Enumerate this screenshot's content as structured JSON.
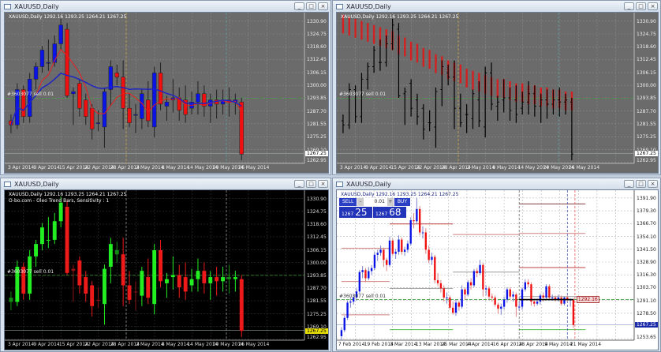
{
  "colors": {
    "gray_bg": "#6b6b6b",
    "black_bg": "#000000",
    "white_bg": "#ffffff",
    "bull_blue": "#0a14e6",
    "bear_red": "#f01010",
    "ma_fast": "#e82020",
    "ma_slow": "#1a22c8",
    "trend_red": "#d42020",
    "oleo_up_strong": "#22ee22",
    "oleo_up_weak": "#148c14",
    "oleo_down_strong": "#ee1a1a",
    "oleo_down_weak": "#8c1414",
    "order_line": "#40a040"
  },
  "common": {
    "window_title": "XAUUSD,Daily",
    "header": "XAUUSD,Daily  1292.16 1293.25 1264.21 1267.25",
    "order_label": "#3603077 sell 0.01",
    "current_price": "1267.25",
    "window_buttons": [
      "minimize-icon",
      "maximize-icon",
      "close-icon"
    ]
  },
  "top_charts": {
    "ylim": [
      1262.5,
      1335
    ],
    "price_labels": [
      "1330.90",
      "1324.75",
      "1318.60",
      "1312.45",
      "1306.15",
      "1300.00",
      "1293.85",
      "1287.70",
      "1281.55",
      "1275.25",
      "1269.10",
      "1262.95"
    ],
    "date_labels": [
      "3 Apr 2014",
      "9 Apr 2014",
      "15 Apr 2014",
      "22 Apr 2014",
      "28 Apr 2014",
      "2 May 2014",
      "8 May 2014",
      "14 May 2014",
      "20 May 2014",
      "26 May 2014"
    ],
    "ohlc": [
      [
        1283,
        1286,
        1277,
        1281
      ],
      [
        1281,
        1301,
        1279,
        1298
      ],
      [
        1298,
        1300,
        1282,
        1285
      ],
      [
        1285,
        1306,
        1282,
        1303
      ],
      [
        1303,
        1311,
        1298,
        1309
      ],
      [
        1309,
        1319,
        1306,
        1317
      ],
      [
        1311,
        1322,
        1307,
        1311
      ],
      [
        1311,
        1324,
        1309,
        1320
      ],
      [
        1320,
        1332,
        1317,
        1329
      ],
      [
        1327,
        1330,
        1294,
        1295
      ],
      [
        1296,
        1299,
        1281,
        1297
      ],
      [
        1301,
        1303,
        1285,
        1289
      ],
      [
        1293,
        1296,
        1281,
        1285
      ],
      [
        1289,
        1291,
        1274,
        1279
      ],
      [
        1282,
        1288,
        1278,
        1282
      ],
      [
        1280,
        1299,
        1270,
        1297
      ],
      [
        1298,
        1312,
        1290,
        1309
      ],
      [
        1306,
        1310,
        1300,
        1304
      ],
      [
        1304,
        1312,
        1279,
        1289
      ],
      [
        1289,
        1296,
        1280,
        1282
      ],
      [
        1286,
        1291,
        1277,
        1286
      ],
      [
        1284,
        1298,
        1279,
        1296
      ],
      [
        1293,
        1302,
        1280,
        1283
      ],
      [
        1280,
        1309,
        1275,
        1306
      ],
      [
        1306,
        1311,
        1288,
        1291
      ],
      [
        1290,
        1295,
        1283,
        1292
      ],
      [
        1293,
        1303,
        1287,
        1294
      ],
      [
        1294,
        1299,
        1283,
        1288
      ],
      [
        1293,
        1300,
        1282,
        1286
      ],
      [
        1289,
        1297,
        1286,
        1292
      ],
      [
        1292,
        1302,
        1286,
        1296
      ],
      [
        1296,
        1300,
        1285,
        1290
      ],
      [
        1290,
        1296,
        1282,
        1293
      ],
      [
        1293,
        1298,
        1284,
        1291
      ],
      [
        1291,
        1298,
        1286,
        1293
      ],
      [
        1293,
        1299,
        1285,
        1292
      ],
      [
        1292,
        1296,
        1286,
        1293
      ],
      [
        1292,
        1294,
        1264,
        1267
      ]
    ],
    "trend_bar_tops": [
      1334,
      1333,
      1332,
      1331,
      1330,
      1329,
      1328,
      1327,
      1326,
      1324,
      1323,
      1321,
      1320,
      1318,
      1317,
      1315,
      1314,
      1312,
      1311,
      1310,
      1308,
      1307,
      1306,
      1305,
      1304,
      1303,
      1303,
      1302,
      1301,
      1301,
      1300,
      1300,
      1299,
      1299,
      1298,
      1298,
      1297,
      1297
    ],
    "order_price": 1293.85
  },
  "bottom_left": {
    "indicator_label": "O-bo.com - Oleo Trend Bars, Sensitivity : 1"
  },
  "bottom_right": {
    "ylim": [
      1252.1,
      1399.5
    ],
    "price_labels": [
      "1391.90",
      "1379.30",
      "1366.70",
      "1354.10",
      "1341.50",
      "1328.90",
      "1316.30",
      "1303.70",
      "1291.10",
      "1278.50",
      "1253.65"
    ],
    "date_labels": [
      "7 Feb 2014",
      "19 Feb 2014",
      "3 Mar 2014",
      "13 Mar 2014",
      "25 Mar 2014",
      "4 Apr 2014",
      "16 Apr 2014",
      "28 Apr 2014",
      "9 May 2014",
      "21 May 2014"
    ],
    "open_price_label": "1292.16",
    "order_price": 1292.0,
    "trade_panel": {
      "sell_label": "SELL",
      "buy_label": "BUY",
      "minus": "-",
      "plus": "+",
      "lot": "0.01",
      "bid_small": "1267",
      "bid_big": "25",
      "ask_small": "1267",
      "ask_big": "68"
    },
    "levels": [
      {
        "price": 1342.4,
        "from": 0,
        "to": 16,
        "color": "#d08080"
      },
      {
        "price": 1309.8,
        "from": 0,
        "to": 16,
        "color": "#d08080"
      },
      {
        "price": 1277,
        "from": 0,
        "to": 16,
        "color": "#d08080"
      },
      {
        "price": 1366.3,
        "from": 16,
        "to": 37,
        "color": "#c04040"
      },
      {
        "price": 1303,
        "from": 16,
        "to": 37,
        "color": "#9a9a9a"
      },
      {
        "price": 1262.5,
        "from": 16,
        "to": 37,
        "color": "#60c060"
      },
      {
        "price": 1356,
        "from": 37,
        "to": 59,
        "color": "#d08080"
      },
      {
        "price": 1319,
        "from": 37,
        "to": 59,
        "color": "#9a9a9a"
      },
      {
        "price": 1386,
        "from": 59,
        "to": 81,
        "color": "#804040"
      },
      {
        "price": 1357,
        "from": 59,
        "to": 81,
        "color": "#d08080"
      },
      {
        "price": 1323.5,
        "from": 59,
        "to": 81,
        "color": "#c04040"
      },
      {
        "price": 1295,
        "from": 59,
        "to": 81,
        "color": "#9a9a9a"
      },
      {
        "price": 1262.5,
        "from": 59,
        "to": 81,
        "color": "#60c060"
      }
    ],
    "ohlc": [
      [
        1256,
        1265,
        1252,
        1262
      ],
      [
        1262,
        1276,
        1260,
        1274
      ],
      [
        1274,
        1291,
        1272,
        1289
      ],
      [
        1289,
        1294,
        1284,
        1290
      ],
      [
        1290,
        1297,
        1287,
        1294
      ],
      [
        1294,
        1303,
        1291,
        1300
      ],
      [
        1300,
        1321,
        1298,
        1319
      ],
      [
        1319,
        1325,
        1313,
        1321
      ],
      [
        1321,
        1323,
        1309,
        1313
      ],
      [
        1313,
        1324,
        1311,
        1320
      ],
      [
        1320,
        1326,
        1316,
        1323
      ],
      [
        1323,
        1339,
        1321,
        1336
      ],
      [
        1336,
        1341,
        1330,
        1338
      ],
      [
        1338,
        1345,
        1335,
        1341
      ],
      [
        1341,
        1343,
        1324,
        1331
      ],
      [
        1331,
        1333,
        1320,
        1326
      ],
      [
        1326,
        1354,
        1324,
        1350
      ],
      [
        1350,
        1352,
        1335,
        1337
      ],
      [
        1337,
        1342,
        1332,
        1339
      ],
      [
        1339,
        1355,
        1336,
        1351
      ],
      [
        1351,
        1353,
        1336,
        1339
      ],
      [
        1339,
        1344,
        1335,
        1341
      ],
      [
        1341,
        1350,
        1338,
        1347
      ],
      [
        1347,
        1373,
        1345,
        1370
      ],
      [
        1370,
        1377,
        1362,
        1369
      ],
      [
        1369,
        1392,
        1366,
        1381
      ],
      [
        1381,
        1384,
        1355,
        1358
      ],
      [
        1358,
        1364,
        1352,
        1358
      ],
      [
        1358,
        1362,
        1337,
        1341
      ],
      [
        1341,
        1345,
        1328,
        1331
      ],
      [
        1331,
        1338,
        1326,
        1334
      ],
      [
        1334,
        1336,
        1308,
        1311
      ],
      [
        1311,
        1318,
        1305,
        1308
      ],
      [
        1308,
        1311,
        1299,
        1303
      ],
      [
        1303,
        1306,
        1290,
        1294
      ],
      [
        1294,
        1299,
        1288,
        1294
      ],
      [
        1294,
        1296,
        1282,
        1284
      ],
      [
        1284,
        1290,
        1277,
        1279
      ],
      [
        1279,
        1292,
        1276,
        1289
      ],
      [
        1289,
        1291,
        1281,
        1285
      ],
      [
        1285,
        1306,
        1283,
        1302
      ],
      [
        1302,
        1304,
        1292,
        1297
      ],
      [
        1297,
        1311,
        1295,
        1309
      ],
      [
        1309,
        1313,
        1302,
        1306
      ],
      [
        1306,
        1322,
        1304,
        1320
      ],
      [
        1320,
        1323,
        1314,
        1318
      ],
      [
        1318,
        1331,
        1316,
        1326
      ],
      [
        1326,
        1328,
        1295,
        1302
      ],
      [
        1302,
        1306,
        1296,
        1303
      ],
      [
        1303,
        1305,
        1292,
        1295
      ],
      [
        1295,
        1298,
        1290,
        1294
      ],
      [
        1294,
        1296,
        1285,
        1287
      ],
      [
        1287,
        1289,
        1278,
        1283
      ],
      [
        1283,
        1288,
        1277,
        1285
      ],
      [
        1285,
        1295,
        1282,
        1292
      ],
      [
        1292,
        1304,
        1289,
        1302
      ],
      [
        1302,
        1304,
        1292,
        1295
      ],
      [
        1295,
        1300,
        1290,
        1297
      ],
      [
        1297,
        1299,
        1275,
        1285
      ],
      [
        1285,
        1290,
        1281,
        1285
      ],
      [
        1285,
        1304,
        1282,
        1302
      ],
      [
        1302,
        1312,
        1300,
        1309
      ],
      [
        1309,
        1312,
        1304,
        1307
      ],
      [
        1307,
        1309,
        1286,
        1290
      ],
      [
        1290,
        1293,
        1285,
        1288
      ],
      [
        1288,
        1293,
        1286,
        1290
      ],
      [
        1290,
        1298,
        1287,
        1296
      ],
      [
        1296,
        1299,
        1290,
        1294
      ],
      [
        1294,
        1307,
        1292,
        1305
      ],
      [
        1305,
        1307,
        1292,
        1294
      ],
      [
        1294,
        1297,
        1291,
        1294
      ],
      [
        1294,
        1296,
        1290,
        1292
      ],
      [
        1292,
        1297,
        1290,
        1294
      ],
      [
        1294,
        1296,
        1286,
        1288
      ],
      [
        1288,
        1295,
        1286,
        1294
      ],
      [
        1294,
        1296,
        1290,
        1292
      ],
      [
        1292,
        1293,
        1285,
        1292
      ],
      [
        1292,
        1293,
        1264,
        1267
      ]
    ]
  }
}
